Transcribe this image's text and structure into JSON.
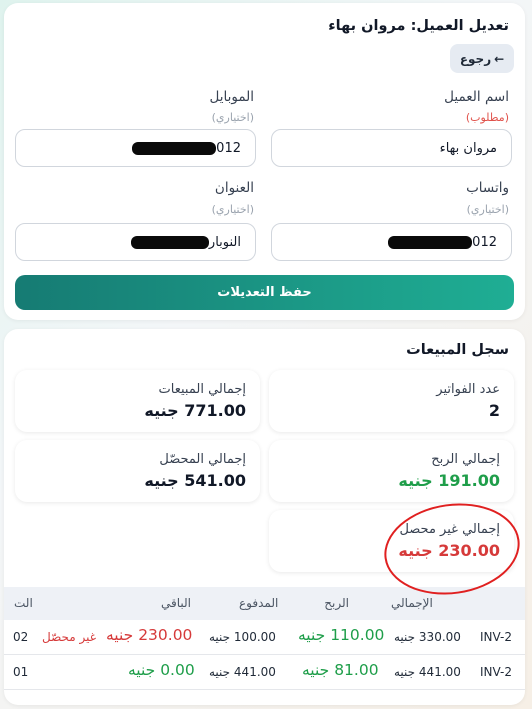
{
  "edit": {
    "title": "تعديل العميل: مروان بهاء",
    "back_label": "رجوع",
    "back_arrow": "←",
    "name_label": "اسم العميل",
    "name_hint": "(مطلوب)",
    "name_value": "مروان بهاء",
    "mobile_label": "الموبايل",
    "mobile_hint": "(اختياري)",
    "mobile_value": "012",
    "whatsapp_label": "واتساب",
    "whatsapp_hint": "(اختياري)",
    "whatsapp_value": "012",
    "address_label": "العنوان",
    "address_hint": "(اختياري)",
    "address_value": "النوبار",
    "save_label": "حفظ التعديلات"
  },
  "sales": {
    "title": "سجل المبيعات",
    "stats": {
      "invoices_label": "عدد الفواتير",
      "invoices_value": "2",
      "total_sales_label": "إجمالي المبيعات",
      "total_sales_value": "771.00 جنيه",
      "profit_label": "إجمالي الربح",
      "profit_value": "191.00 جنيه",
      "collected_label": "إجمالي المحصّل",
      "collected_value": "541.00 جنيه",
      "uncollected_label": "إجمالي غير محصل",
      "uncollected_value": "230.00 جنيه"
    },
    "columns": [
      "الإجمالي",
      "الربح",
      "المدفوع",
      "الباقي",
      "الت"
    ],
    "rows": [
      {
        "invoice": "INV-2",
        "total": "330.00 جنيه",
        "profit": "110.00 جنيه",
        "paid": "100.00 جنيه",
        "remaining": "230.00 جنيه",
        "status": "غير محصّل",
        "date": "02"
      },
      {
        "invoice": "INV-2",
        "total": "441.00 جنيه",
        "profit": "81.00 جنيه",
        "paid": "441.00 جنيه",
        "remaining": "0.00 جنيه",
        "status": "",
        "date": "01"
      }
    ]
  },
  "colors": {
    "accent_start": "#167b73",
    "accent_end": "#1fae94",
    "green": "#1f9e4a",
    "red": "#d63a3a"
  }
}
